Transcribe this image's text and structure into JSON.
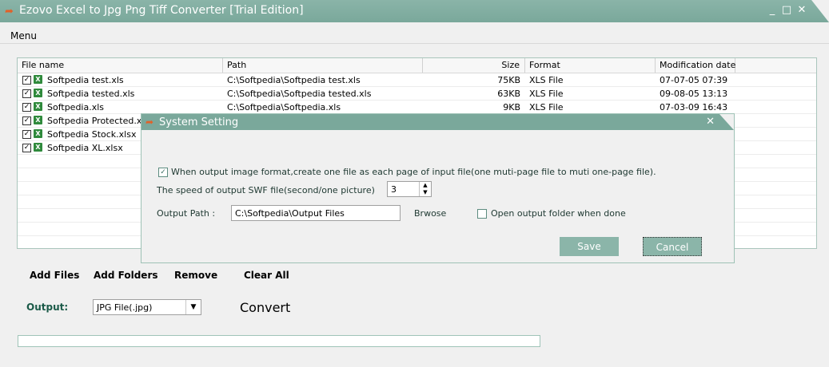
{
  "window": {
    "title": "Ezovo Excel to Jpg Png Tiff Converter [Trial Edition]",
    "minimize": "_",
    "maximize": "□",
    "close": "✕"
  },
  "menu": {
    "label": "Menu"
  },
  "filelist": {
    "columns": [
      "File name",
      "Path",
      "Size",
      "Format",
      "Modification date"
    ],
    "rows": [
      {
        "name": "Softpedia test.xls",
        "path": "C:\\Softpedia\\Softpedia test.xls",
        "size": "75KB",
        "format": "XLS File",
        "date": "07-07-05 07:39",
        "checked": "✓"
      },
      {
        "name": "Softpedia tested.xls",
        "path": "C:\\Softpedia\\Softpedia tested.xls",
        "size": "63KB",
        "format": "XLS File",
        "date": "09-08-05 13:13",
        "checked": "✓"
      },
      {
        "name": "Softpedia.xls",
        "path": "C:\\Softpedia\\Softpedia.xls",
        "size": "9KB",
        "format": "XLS File",
        "date": "07-03-09 16:43",
        "checked": "✓"
      },
      {
        "name": "Softpedia Protected.xlsx",
        "checked": "✓"
      },
      {
        "name": "Softpedia Stock.xlsx",
        "checked": "✓"
      },
      {
        "name": "Softpedia XL.xlsx",
        "checked": "✓"
      }
    ]
  },
  "actions": {
    "add_files": "Add Files",
    "add_folders": "Add Folders",
    "remove": "Remove",
    "clear_all": "Clear All"
  },
  "output": {
    "label": "Output:",
    "selected": "JPG File(.jpg)",
    "convert": "Convert",
    "progress": 0
  },
  "dialog": {
    "title": "System Setting",
    "close": "✕",
    "one_file_option": {
      "label": "When output image format,create one file as each page of input file(one muti-page file to muti one-page file).",
      "checked": "✓"
    },
    "swf_speed": {
      "label": "The speed of output SWF file(second/one picture)",
      "value": "3"
    },
    "output_path": {
      "label": "Output Path :",
      "value": "C:\\Softpedia\\Output Files",
      "browse": "Brwose"
    },
    "open_folder": {
      "label": "Open output folder when done",
      "checked": ""
    },
    "save": "Save",
    "cancel": "Cancel"
  },
  "colors": {
    "accent": "#7aa89b",
    "button": "#8bb5a9",
    "output_label": "#1b5a48"
  }
}
